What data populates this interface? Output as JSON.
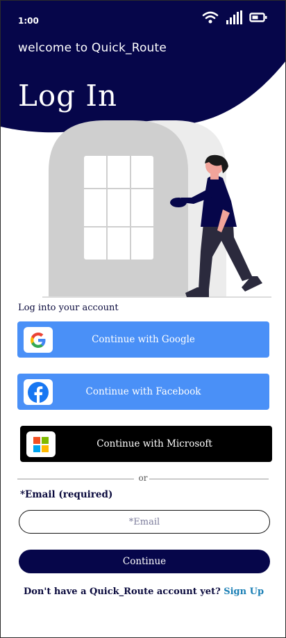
{
  "status_bar": {
    "time": "1:00",
    "icons": [
      "wifi-icon",
      "signal-icon",
      "battery-icon"
    ]
  },
  "header": {
    "welcome": "welcome to Quick_Route",
    "title": "Log In"
  },
  "section_label": "Log into your account",
  "buttons": {
    "google": {
      "label": "Continue with Google",
      "icon": "google-icon"
    },
    "facebook": {
      "label": "Continue with Facebook",
      "icon": "facebook-icon"
    },
    "microsoft": {
      "label": "Continue with Microsoft",
      "icon": "microsoft-icon"
    }
  },
  "divider_text": "or",
  "email": {
    "label": "*Email (required)",
    "placeholder": "*Email",
    "value": ""
  },
  "continue_label": "Continue",
  "signup": {
    "prompt": "Don't have a Quick_Route account yet?",
    "link": "Sign Up"
  },
  "colors": {
    "header": "#06064a",
    "social_blue": "#4a90f7",
    "link": "#1a7fb5"
  }
}
